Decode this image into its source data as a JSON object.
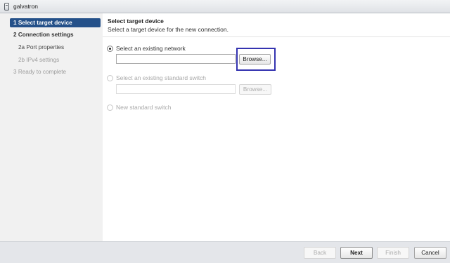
{
  "window": {
    "title": "galvatron",
    "icon": "device-icon"
  },
  "sidebar": {
    "steps": [
      {
        "label": "1  Select target device",
        "state": "active"
      },
      {
        "label": "2  Connection settings",
        "state": "normal"
      },
      {
        "label": "2a  Port properties",
        "state": "normal"
      },
      {
        "label": "2b  IPv4 settings",
        "state": "disabled"
      },
      {
        "label": "3  Ready to complete",
        "state": "disabled"
      }
    ]
  },
  "content": {
    "title": "Select target device",
    "subtitle": "Select a target device for the new connection.",
    "options": {
      "existing_network": {
        "label": "Select an existing network",
        "selected": true,
        "value": "",
        "browse_label": "Browse..."
      },
      "existing_switch": {
        "label": "Select an existing standard switch",
        "selected": false,
        "enabled": false,
        "value": "",
        "browse_label": "Browse..."
      },
      "new_switch": {
        "label": "New standard switch",
        "selected": false,
        "enabled": false
      }
    }
  },
  "footer": {
    "back_label": "Back",
    "next_label": "Next",
    "finish_label": "Finish",
    "cancel_label": "Cancel"
  },
  "colors": {
    "accent": "#245089",
    "highlight": "#3433b0"
  }
}
